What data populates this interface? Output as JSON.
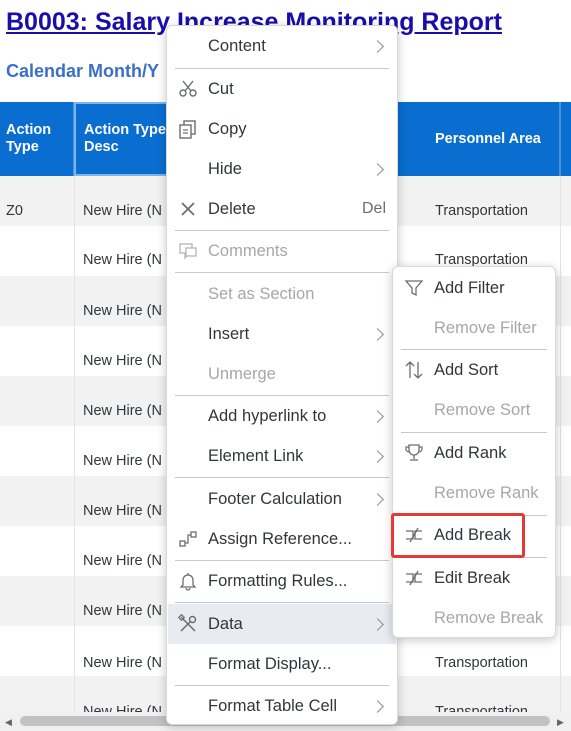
{
  "report": {
    "title": "B0003: Salary Increase Monitoring Report",
    "subtitle": "Calendar Month/Y"
  },
  "table": {
    "headers": {
      "action_type": "Action Type",
      "action_type_desc": "Action Type Desc",
      "personnel_area": "Personnel Area"
    },
    "rows": [
      {
        "type": "Z0",
        "desc": "New Hire (N",
        "area": "Transportation"
      },
      {
        "type": "",
        "desc": "New Hire (N",
        "area": "Transportation"
      },
      {
        "type": "",
        "desc": "New Hire (N",
        "area": ""
      },
      {
        "type": "",
        "desc": "New Hire (N",
        "area": ""
      },
      {
        "type": "",
        "desc": "New Hire (N",
        "area": ""
      },
      {
        "type": "",
        "desc": "New Hire (N",
        "area": ""
      },
      {
        "type": "",
        "desc": "New Hire (N",
        "area": ""
      },
      {
        "type": "",
        "desc": "New Hire (N",
        "area": ""
      },
      {
        "type": "",
        "desc": "New Hire (N",
        "area": ""
      },
      {
        "type": "",
        "desc": "New Hire (N",
        "area": "Transportation"
      },
      {
        "type": "",
        "desc": "New Hire (N",
        "area": "Transportation"
      }
    ]
  },
  "context_menu": {
    "items": {
      "content": "Content",
      "cut": "Cut",
      "copy": "Copy",
      "hide": "Hide",
      "delete": "Delete",
      "delete_shortcut": "Del",
      "comments": "Comments",
      "set_as_section": "Set as Section",
      "insert": "Insert",
      "unmerge": "Unmerge",
      "add_hyperlink": "Add hyperlink to",
      "element_link": "Element Link",
      "footer_calculation": "Footer Calculation",
      "assign_reference": "Assign Reference...",
      "formatting_rules": "Formatting Rules...",
      "data": "Data",
      "format_display": "Format Display...",
      "format_table_cell": "Format Table Cell"
    }
  },
  "data_submenu": {
    "items": {
      "add_filter": "Add Filter",
      "remove_filter": "Remove Filter",
      "add_sort": "Add Sort",
      "remove_sort": "Remove Sort",
      "add_rank": "Add Rank",
      "remove_rank": "Remove Rank",
      "add_break": "Add Break",
      "edit_break": "Edit Break",
      "remove_break": "Remove Break"
    }
  },
  "colors": {
    "header_blue": "#0a6ed1",
    "title_link": "#1a0dab",
    "highlight": "#e53935"
  }
}
